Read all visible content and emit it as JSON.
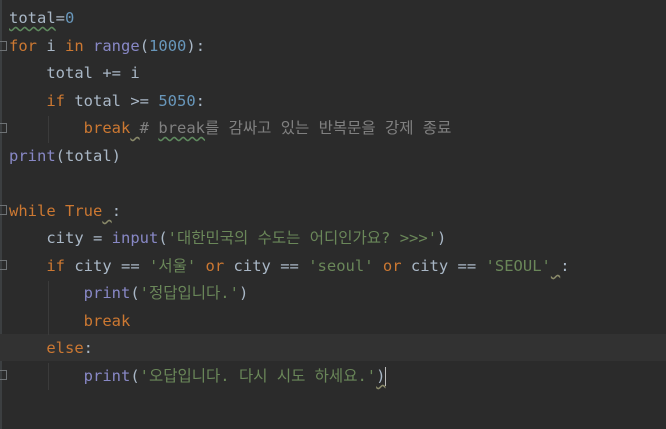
{
  "colors": {
    "background": "#2b2b2b",
    "keyword": "#cc7832",
    "number": "#6897bb",
    "string": "#6a8759",
    "builtin": "#8888c6",
    "comment": "#808080",
    "text": "#a9b7c6"
  },
  "code": {
    "l1": {
      "a": "total",
      "b": "=",
      "c": "0"
    },
    "l2": {
      "kw_for": "for",
      "a": " i ",
      "kw_in": "in",
      "sp": " ",
      "range": "range",
      "p1": "(",
      "n": "1000",
      "p2": "):"
    },
    "l3": {
      "a": "    total += i"
    },
    "l4": {
      "ind": "    ",
      "kw_if": "if",
      "a": " total >= ",
      "n": "5050",
      "b": ":"
    },
    "l5": {
      "ind": "        ",
      "kw_break": "break",
      "sp": " ",
      "cm_hash": "#",
      "cm_sp": " ",
      "cm_word": "break",
      "cm_rest": "를 감싸고 있는 반복문을 강제 종료"
    },
    "l6": {
      "fn": "print",
      "a": "(total)"
    },
    "l8": {
      "kw_while": "while",
      "sp": " ",
      "kw_true": "True",
      "sp2": " ",
      "b": ":"
    },
    "l9": {
      "ind": "    ",
      "a": "city = ",
      "fn": "input",
      "p1": "(",
      "s": "'대한민국의 수도는 어디인가요? >>>'",
      "p2": ")"
    },
    "l10": {
      "ind": "    ",
      "kw_if": "if",
      "a": " city == ",
      "s1": "'서울'",
      "sp1": " ",
      "kw_or1": "or",
      "b": " city == ",
      "s2": "'seoul'",
      "sp2": " ",
      "kw_or2": "or",
      "c": " city == ",
      "s3": "'SEOUL'",
      "sp3": " ",
      "d": ":"
    },
    "l11": {
      "ind": "        ",
      "fn": "print",
      "p1": "(",
      "s": "'정답입니다.'",
      "p2": ")"
    },
    "l12": {
      "ind": "        ",
      "kw_break": "break"
    },
    "l13": {
      "ind": "    ",
      "kw_else": "else",
      "b": ":"
    },
    "l14": {
      "ind": "        ",
      "fn": "print",
      "p1": "(",
      "s": "'오답입니다. 다시 시도 하세요.'",
      "p2": ")"
    }
  }
}
